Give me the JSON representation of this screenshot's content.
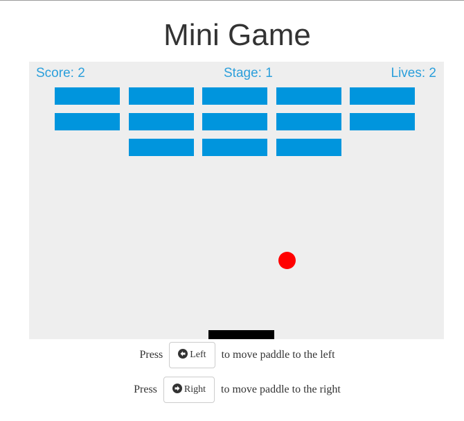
{
  "title": "Mini Game",
  "hud": {
    "score": "Score: 2",
    "stage": "Stage: 1",
    "lives": "Lives: 2"
  },
  "bricks": {
    "rows": 3,
    "cols": 5,
    "color": "#0095dd",
    "present": [
      [
        true,
        true,
        true,
        true,
        true
      ],
      [
        true,
        true,
        true,
        true,
        true
      ],
      [
        false,
        true,
        true,
        true,
        false
      ]
    ]
  },
  "ball": {
    "color": "#ff0000"
  },
  "paddle": {
    "color": "#000000"
  },
  "canvas": {
    "background": "#eeeeee"
  },
  "controls": {
    "left": {
      "prefix": "Press",
      "button_label": "Left",
      "icon": "arrow-left-circle-icon",
      "suffix": "to move paddle to the left"
    },
    "right": {
      "prefix": "Press",
      "button_label": "Right",
      "icon": "arrow-right-circle-icon",
      "suffix": "to move paddle to the right"
    }
  }
}
